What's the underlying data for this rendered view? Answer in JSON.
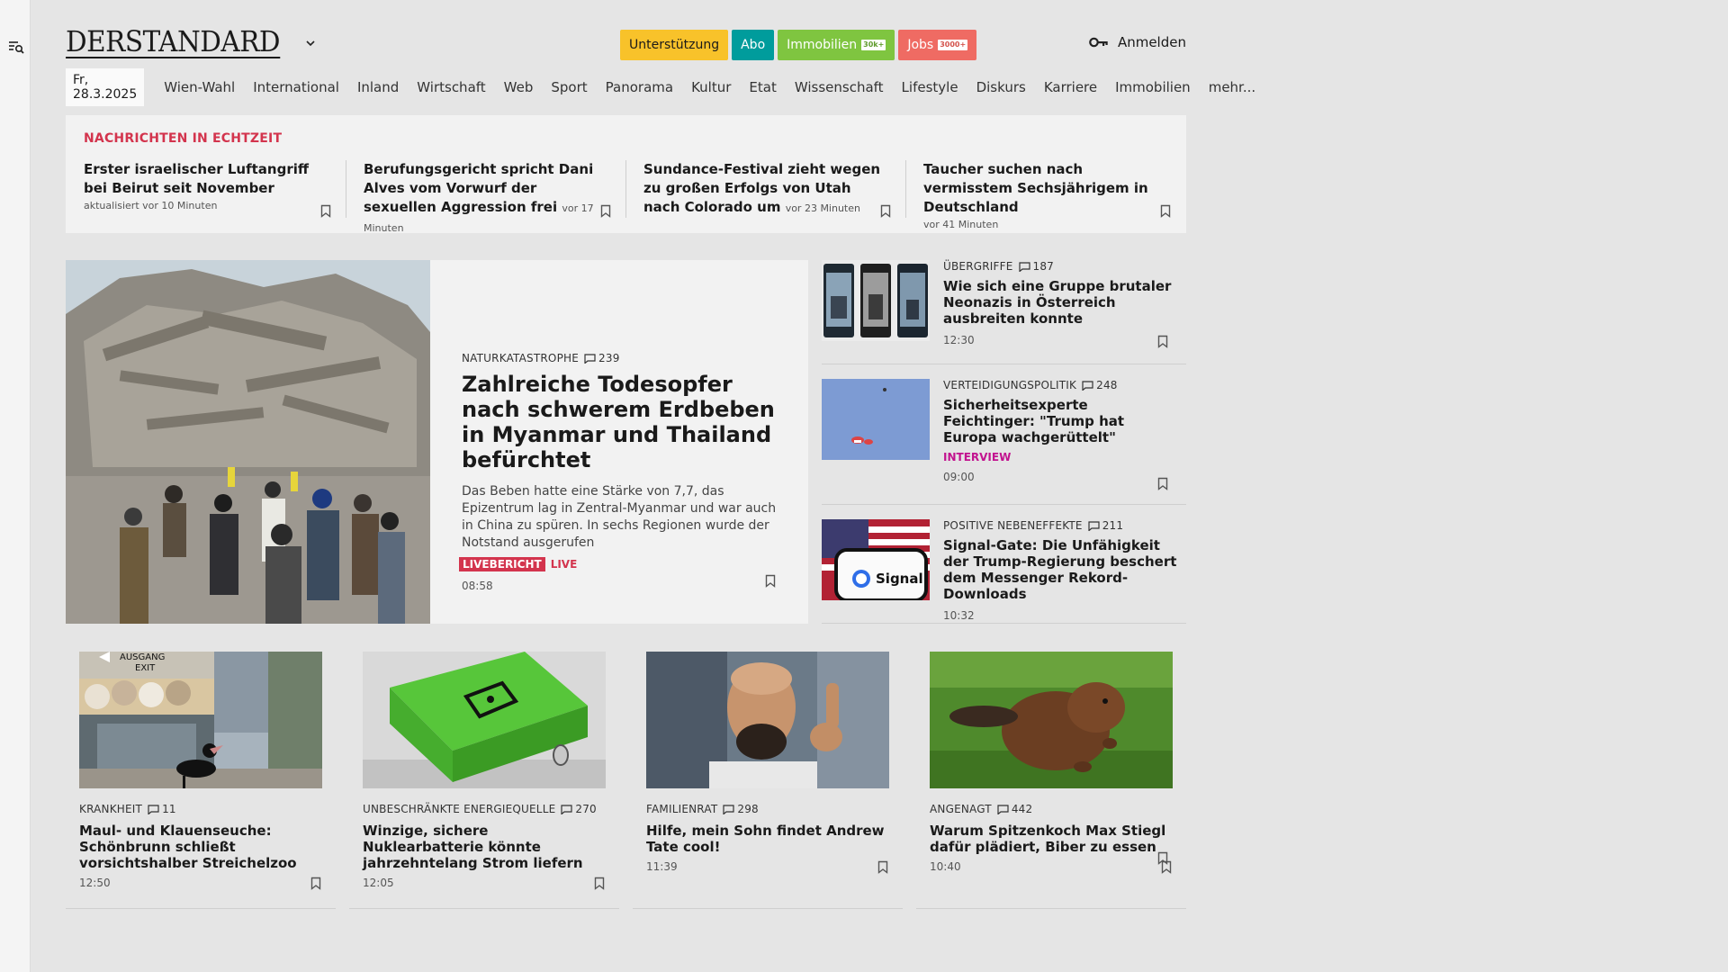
{
  "header": {
    "logo": "DERSTANDARD",
    "pills": [
      {
        "label": "Unterstützung",
        "tag": ""
      },
      {
        "label": "Abo",
        "tag": ""
      },
      {
        "label": "Immobilien",
        "tag": "30k+"
      },
      {
        "label": "Jobs",
        "tag": "3000+"
      }
    ],
    "login": "Anmelden"
  },
  "nav": {
    "date": "Fr, 28.3.2025",
    "items": [
      "Wien-Wahl",
      "International",
      "Inland",
      "Wirtschaft",
      "Web",
      "Sport",
      "Panorama",
      "Kultur",
      "Etat",
      "Wissenschaft",
      "Lifestyle",
      "Diskurs",
      "Karriere",
      "Immobilien",
      "mehr..."
    ]
  },
  "ticker": {
    "title": "NACHRICHTEN IN ECHTZEIT",
    "items": [
      {
        "title": "Erster israelischer Luftangriff bei Beirut seit November",
        "meta": "aktualisiert vor 10 Minuten"
      },
      {
        "title": "Berufungsgericht spricht Dani Alves vom Vorwurf der sexuellen Aggression frei",
        "meta": "vor 17 Minuten"
      },
      {
        "title": "Sundance-Festival zieht wegen zu großen Erfolgs von Utah nach Colorado um",
        "meta": "vor 23 Minuten"
      },
      {
        "title": "Taucher suchen nach vermisstem Sechsjährigem in Deutschland",
        "meta": "vor 41 Minuten"
      }
    ]
  },
  "hero": {
    "kicker": "NATURKATASTROPHE",
    "comments": "239",
    "title": "Zahlreiche Todesopfer nach schwerem Erdbeben in Myanmar und Thailand befürchtet",
    "teaser": "Das Beben hatte eine Stärke von 7,7, das Epizentrum lag in Zentral-Myanmar und war auch in China zu spüren. In sechs Regionen wurde der Notstand ausgerufen",
    "badge": "LIVEBERICHT",
    "live": "LIVE",
    "time": "08:58"
  },
  "side": [
    {
      "kicker": "ÜBERGRIFFE",
      "comments": "187",
      "title": "Wie sich eine Gruppe brutaler Neonazis in Österreich ausbreiten konnte",
      "label": "",
      "time": "12:30"
    },
    {
      "kicker": "VERTEIDIGUNGSPOLITIK",
      "comments": "248",
      "title": "Sicherheitsexperte Feichtinger: \"Trump hat Europa wachgerüttelt\"",
      "label": "INTERVIEW",
      "time": "09:00"
    },
    {
      "kicker": "POSITIVE NEBENEFFEKTE",
      "comments": "211",
      "title": "Signal-Gate: Die Unfähigkeit der Trump-Regierung beschert dem Messenger Rekord-Downloads",
      "label": "",
      "time": "10:32",
      "img_text": "Signal"
    }
  ],
  "cards": [
    {
      "kicker": "KRANKHEIT",
      "comments": "11",
      "title": "Maul- und Klauenseuche: Schönbrunn schließt vorsichtshalber Streichelzoo",
      "time": "12:50",
      "sign": [
        "AUSGANG",
        "EXIT"
      ]
    },
    {
      "kicker": "UNBESCHRÄNKTE ENERGIEQUELLE",
      "comments": "270",
      "title": "Winzige, sichere Nuklearbatterie könnte jahrzehntelang Strom liefern",
      "time": "12:05"
    },
    {
      "kicker": "FAMILIENRAT",
      "comments": "298",
      "title": "Hilfe, mein Sohn findet Andrew Tate cool!",
      "time": "11:39"
    },
    {
      "kicker": "ANGENAGT",
      "comments": "442",
      "title": "Warum Spitzenkoch Max Stiegl dafür plädiert, Biber zu essen",
      "time": "10:40"
    }
  ],
  "colors": {
    "accent_red": "#d3344d",
    "interview_magenta": "#c2138f",
    "pill_yellow": "#f8c22a",
    "pill_teal": "#009c9c",
    "pill_green": "#7fc540",
    "pill_red": "#ef6b63"
  }
}
